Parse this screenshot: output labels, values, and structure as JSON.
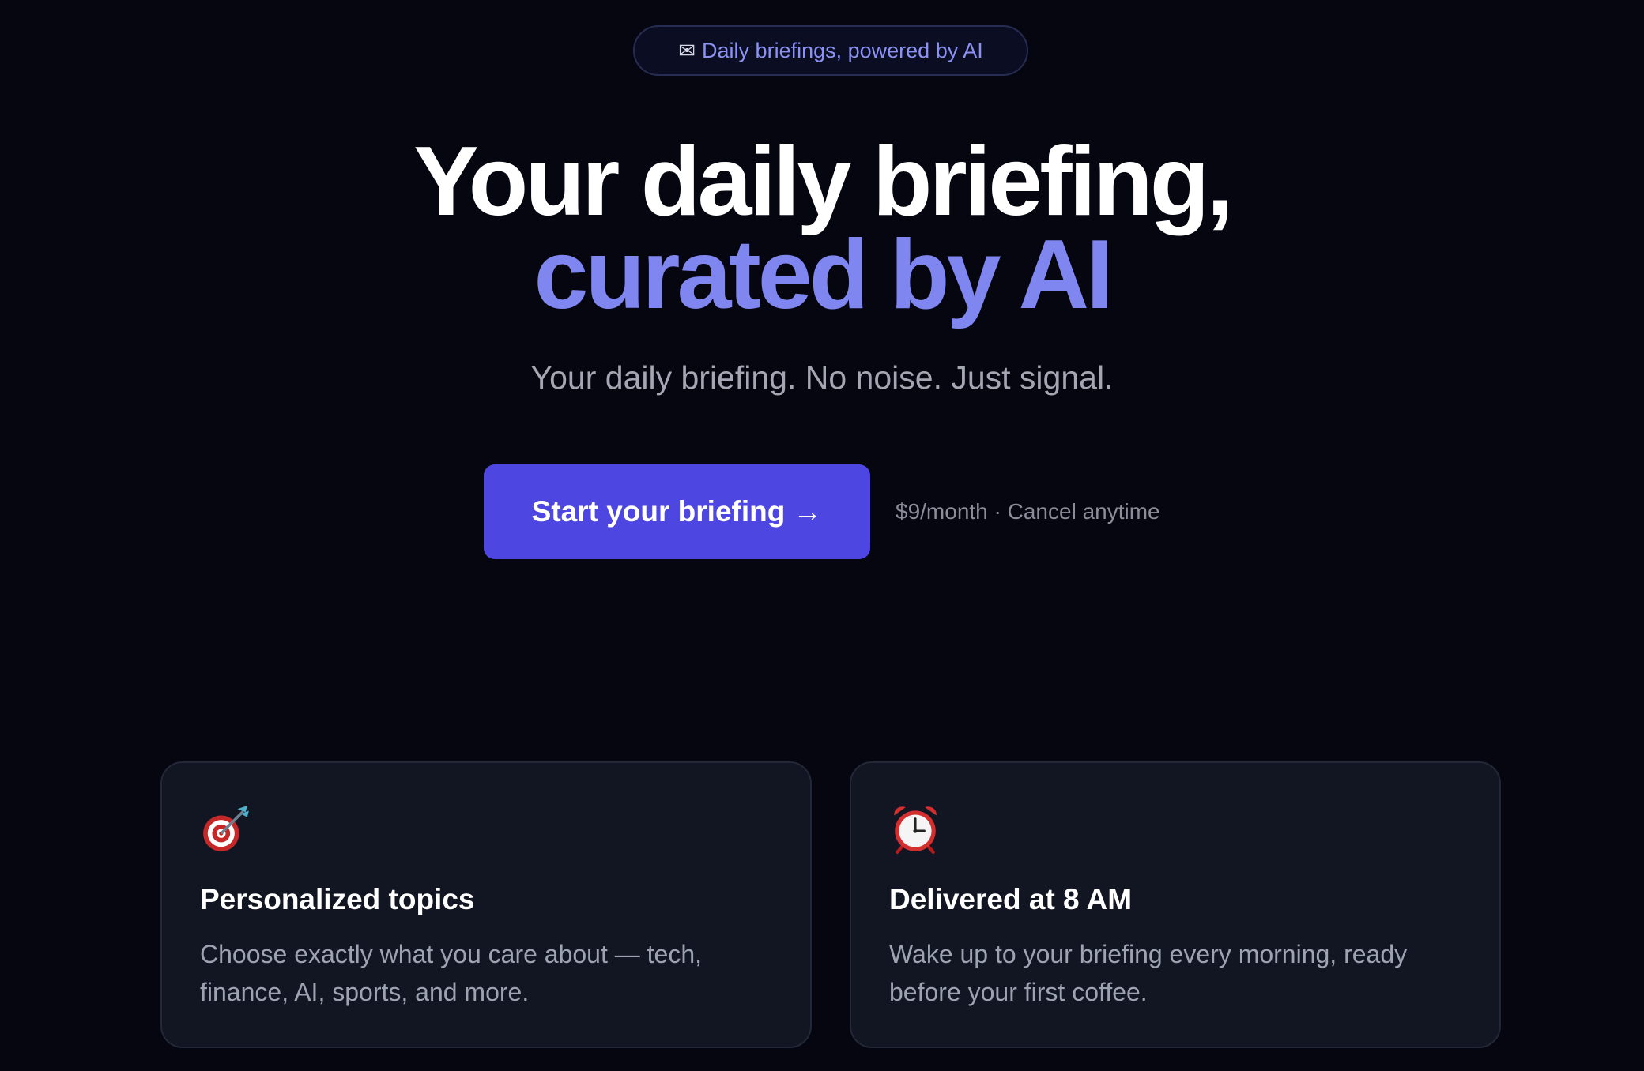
{
  "badge": {
    "icon": "envelope-icon",
    "text": "Daily briefings, powered by AI"
  },
  "hero": {
    "headline_line1": "Your daily briefing,",
    "headline_line2": "curated by AI",
    "subheadline": "Your daily briefing. No noise. Just signal."
  },
  "cta": {
    "label": "Start your briefing",
    "arrow": "→",
    "pricing": "$9/month · Cancel anytime"
  },
  "features": [
    {
      "icon": "target-icon",
      "title": "Personalized topics",
      "description": "Choose exactly what you care about — tech, finance, AI, sports, and more."
    },
    {
      "icon": "alarm-clock-icon",
      "title": "Delivered at 8 AM",
      "description": "Wake up to your briefing every morning, ready before your first coffee."
    }
  ],
  "colors": {
    "background": "#05060f",
    "accent": "#7f86f0",
    "button": "#4e46e0",
    "card": "#121622"
  }
}
